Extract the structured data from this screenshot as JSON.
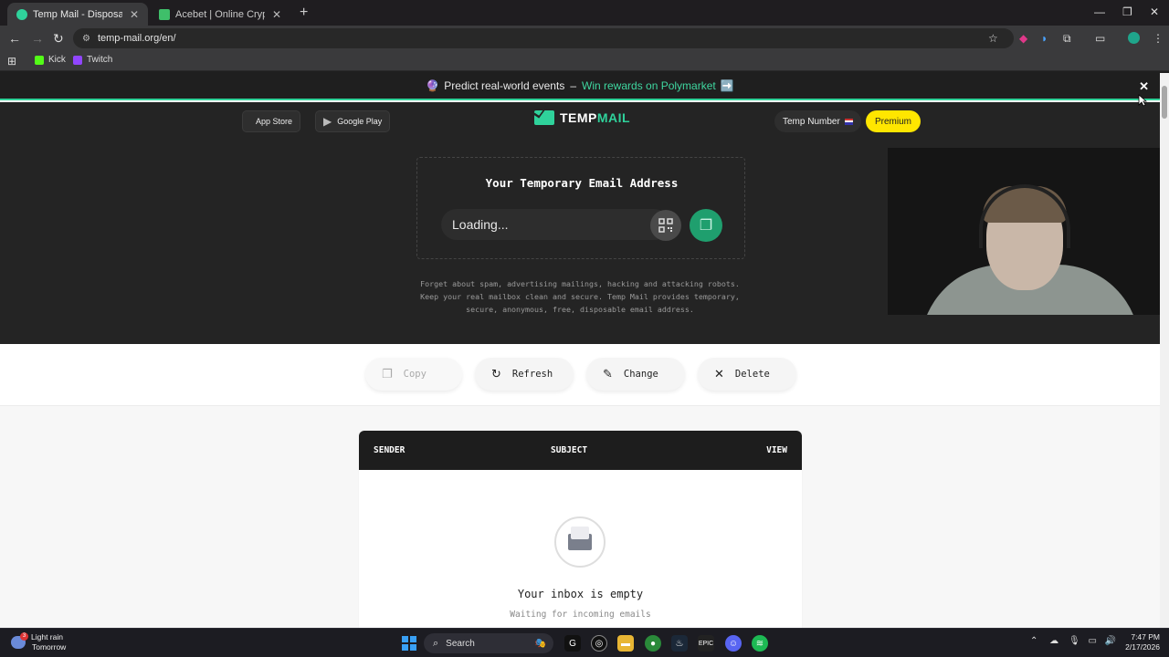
{
  "browser": {
    "tabs": [
      {
        "title": "Temp Mail - Disposable Tempo",
        "active": true,
        "favicon_color": "#2fd29b"
      },
      {
        "title": "Acebet | Online Crypto Casino",
        "active": false,
        "favicon_color": "#3fbf6a"
      }
    ],
    "url": "temp-mail.org/en/",
    "bookmarks": [
      {
        "label": "Kick",
        "icon_color": "#53fc18"
      },
      {
        "label": "Twitch",
        "icon_color": "#9146ff"
      }
    ]
  },
  "promo": {
    "text": "Predict real-world events",
    "dash": "–",
    "link": "Win rewards on Polymarket",
    "arrow": "➡️"
  },
  "header": {
    "app_store": "App Store",
    "google_play": "Google Play",
    "logo_temp": "TEMP",
    "logo_mail": "MAIL",
    "temp_number": "Temp Number",
    "premium": "Premium"
  },
  "email_box": {
    "title": "Your Temporary Email Address",
    "value": "Loading..."
  },
  "tagline": {
    "line1": "Forget about spam, advertising mailings, hacking and attacking robots.",
    "line2": "Keep your real mailbox clean and secure. Temp Mail provides temporary,",
    "line3": "secure, anonymous, free, disposable email address."
  },
  "actions": {
    "copy": "Copy",
    "refresh": "Refresh",
    "change": "Change",
    "delete": "Delete"
  },
  "inbox": {
    "col_sender": "SENDER",
    "col_subject": "SUBJECT",
    "col_view": "VIEW",
    "empty_title": "Your inbox is empty",
    "empty_sub": "Waiting for incoming emails"
  },
  "taskbar": {
    "weather_title": "Light rain",
    "weather_sub": "Tomorrow",
    "weather_badge": "3",
    "search": "Search",
    "time": "7:47 PM",
    "date": "2/17/2026"
  },
  "colors": {
    "accent": "#2fd29b",
    "premium": "#ffe600",
    "hero_bg": "#242424"
  }
}
